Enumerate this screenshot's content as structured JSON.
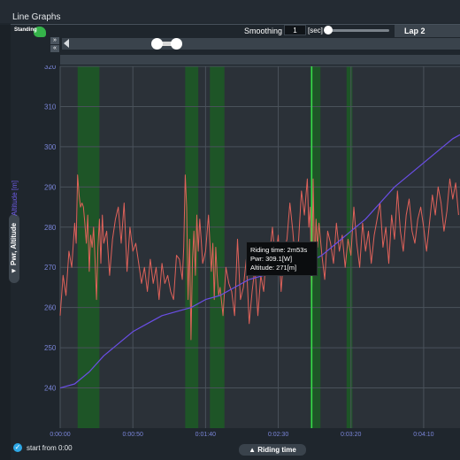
{
  "window": {
    "title": "Line Graphs"
  },
  "logo": {
    "text": "Standing"
  },
  "toolbar": {
    "smoothing_label": "Smoothing :",
    "smoothing_value": "1",
    "smoothing_unit": "[sec]",
    "lap_label": "Lap 2",
    "nav_next": "»",
    "nav_prev": "«"
  },
  "y_panel": {
    "tab_label": "▼ Pwr, Altitude",
    "axis_label": "Altitude [m]"
  },
  "x_panel": {
    "tab_label": "▲ Riding time"
  },
  "footer": {
    "start_label": "start from 0:00",
    "check_glyph": "✓"
  },
  "tooltip": {
    "time": "Riding time: 2m53s",
    "power": "Pwr: 309.1[W]",
    "altitude": "Altitude: 271[m]"
  },
  "colors": {
    "power": "#e0625a",
    "altitude": "#6a4ee6",
    "highlight": "#1d5a26",
    "cursor": "#39e04c",
    "grid": "#4a525b",
    "plot_bg": "#2b3138",
    "tick_text": "#7a85d8"
  },
  "chart_data": {
    "type": "line",
    "xlabel": "Riding time",
    "ylabel": "Altitude [m]",
    "xlim": [
      0,
      275
    ],
    "ylim": [
      230,
      320
    ],
    "x_ticks": [
      "0:00:00",
      "0:00:50",
      "0:01:40",
      "0:02:30",
      "0:03:20",
      "0:04:10"
    ],
    "x_tick_values": [
      0,
      50,
      100,
      150,
      200,
      250
    ],
    "y_ticks": [
      "240",
      "250",
      "260",
      "270",
      "280",
      "290",
      "300",
      "310",
      "320"
    ],
    "y_tick_values": [
      240,
      250,
      260,
      270,
      280,
      290,
      300,
      310,
      320
    ],
    "grid": true,
    "highlight_ranges": [
      [
        12,
        27
      ],
      [
        86,
        95
      ],
      [
        103,
        113
      ],
      [
        172,
        179
      ],
      [
        197,
        201
      ]
    ],
    "cursor_x": 173,
    "series": [
      {
        "color_key": "power",
        "x": [
          0,
          2,
          4,
          6,
          8,
          10,
          11,
          12,
          13,
          14,
          15,
          16,
          17,
          18,
          19,
          20,
          21,
          22,
          23,
          24,
          25,
          26,
          27,
          28,
          29,
          30,
          32,
          34,
          36,
          38,
          40,
          42,
          44,
          46,
          48,
          50,
          52,
          54,
          56,
          58,
          60,
          62,
          64,
          66,
          68,
          70,
          72,
          74,
          76,
          78,
          80,
          82,
          84,
          85,
          86,
          87,
          88,
          89,
          90,
          91,
          92,
          93,
          94,
          95,
          96,
          97,
          98,
          100,
          102,
          104,
          105,
          106,
          107,
          108,
          109,
          110,
          112,
          114,
          116,
          118,
          120,
          122,
          124,
          126,
          128,
          130,
          132,
          134,
          136,
          138,
          140,
          142,
          144,
          146,
          148,
          150,
          152,
          154,
          156,
          158,
          160,
          162,
          164,
          166,
          168,
          170,
          171,
          172,
          173,
          174,
          175,
          176,
          177,
          178,
          180,
          182,
          184,
          186,
          188,
          190,
          192,
          194,
          196,
          198,
          200,
          202,
          204,
          206,
          208,
          210,
          212,
          214,
          216,
          218,
          220,
          222,
          224,
          226,
          228,
          230,
          232,
          234,
          236,
          238,
          240,
          242,
          244,
          246,
          248,
          250,
          252,
          254,
          256,
          258,
          260,
          262,
          264,
          266,
          268,
          270,
          272,
          274
        ],
        "y": [
          258,
          268,
          263,
          274,
          270,
          281,
          276,
          293,
          288,
          285,
          286,
          285,
          281,
          276,
          283,
          269,
          278,
          275,
          280,
          272,
          262,
          275,
          282,
          271,
          283,
          276,
          279,
          268,
          277,
          282,
          285,
          276,
          286,
          269,
          280,
          274,
          276,
          271,
          266,
          270,
          264,
          272,
          266,
          270,
          262,
          271,
          266,
          268,
          264,
          262,
          273,
          272,
          267,
          275,
          293,
          285,
          262,
          277,
          252,
          272,
          279,
          268,
          283,
          274,
          282,
          277,
          271,
          274,
          283,
          269,
          276,
          262,
          275,
          268,
          263,
          265,
          258,
          270,
          266,
          264,
          258,
          277,
          262,
          265,
          272,
          256,
          264,
          270,
          258,
          268,
          264,
          275,
          273,
          280,
          271,
          278,
          264,
          274,
          277,
          286,
          279,
          270,
          277,
          289,
          283,
          292,
          280,
          285,
          261,
          292,
          270,
          282,
          275,
          281,
          273,
          267,
          279,
          276,
          271,
          281,
          274,
          278,
          270,
          277,
          273,
          285,
          276,
          270,
          281,
          274,
          279,
          271,
          278,
          282,
          286,
          275,
          280,
          271,
          283,
          277,
          289,
          279,
          274,
          283,
          287,
          279,
          276,
          282,
          285,
          280,
          274,
          281,
          288,
          283,
          290,
          286,
          279,
          284,
          292,
          287,
          291,
          283
        ],
        "name": ""
      },
      {
        "color_key": "altitude",
        "x": [
          0,
          10,
          20,
          30,
          40,
          50,
          60,
          70,
          80,
          90,
          100,
          110,
          120,
          130,
          140,
          150,
          160,
          170,
          180,
          190,
          200,
          210,
          220,
          230,
          240,
          250,
          260,
          270,
          275
        ],
        "y": [
          240,
          241,
          244,
          248,
          251,
          254,
          256,
          258,
          259,
          260,
          262,
          263,
          265,
          267,
          268,
          269,
          270,
          271,
          273,
          276,
          279,
          282,
          286,
          290,
          293,
          296,
          299,
          302,
          303
        ],
        "name": ""
      }
    ]
  }
}
